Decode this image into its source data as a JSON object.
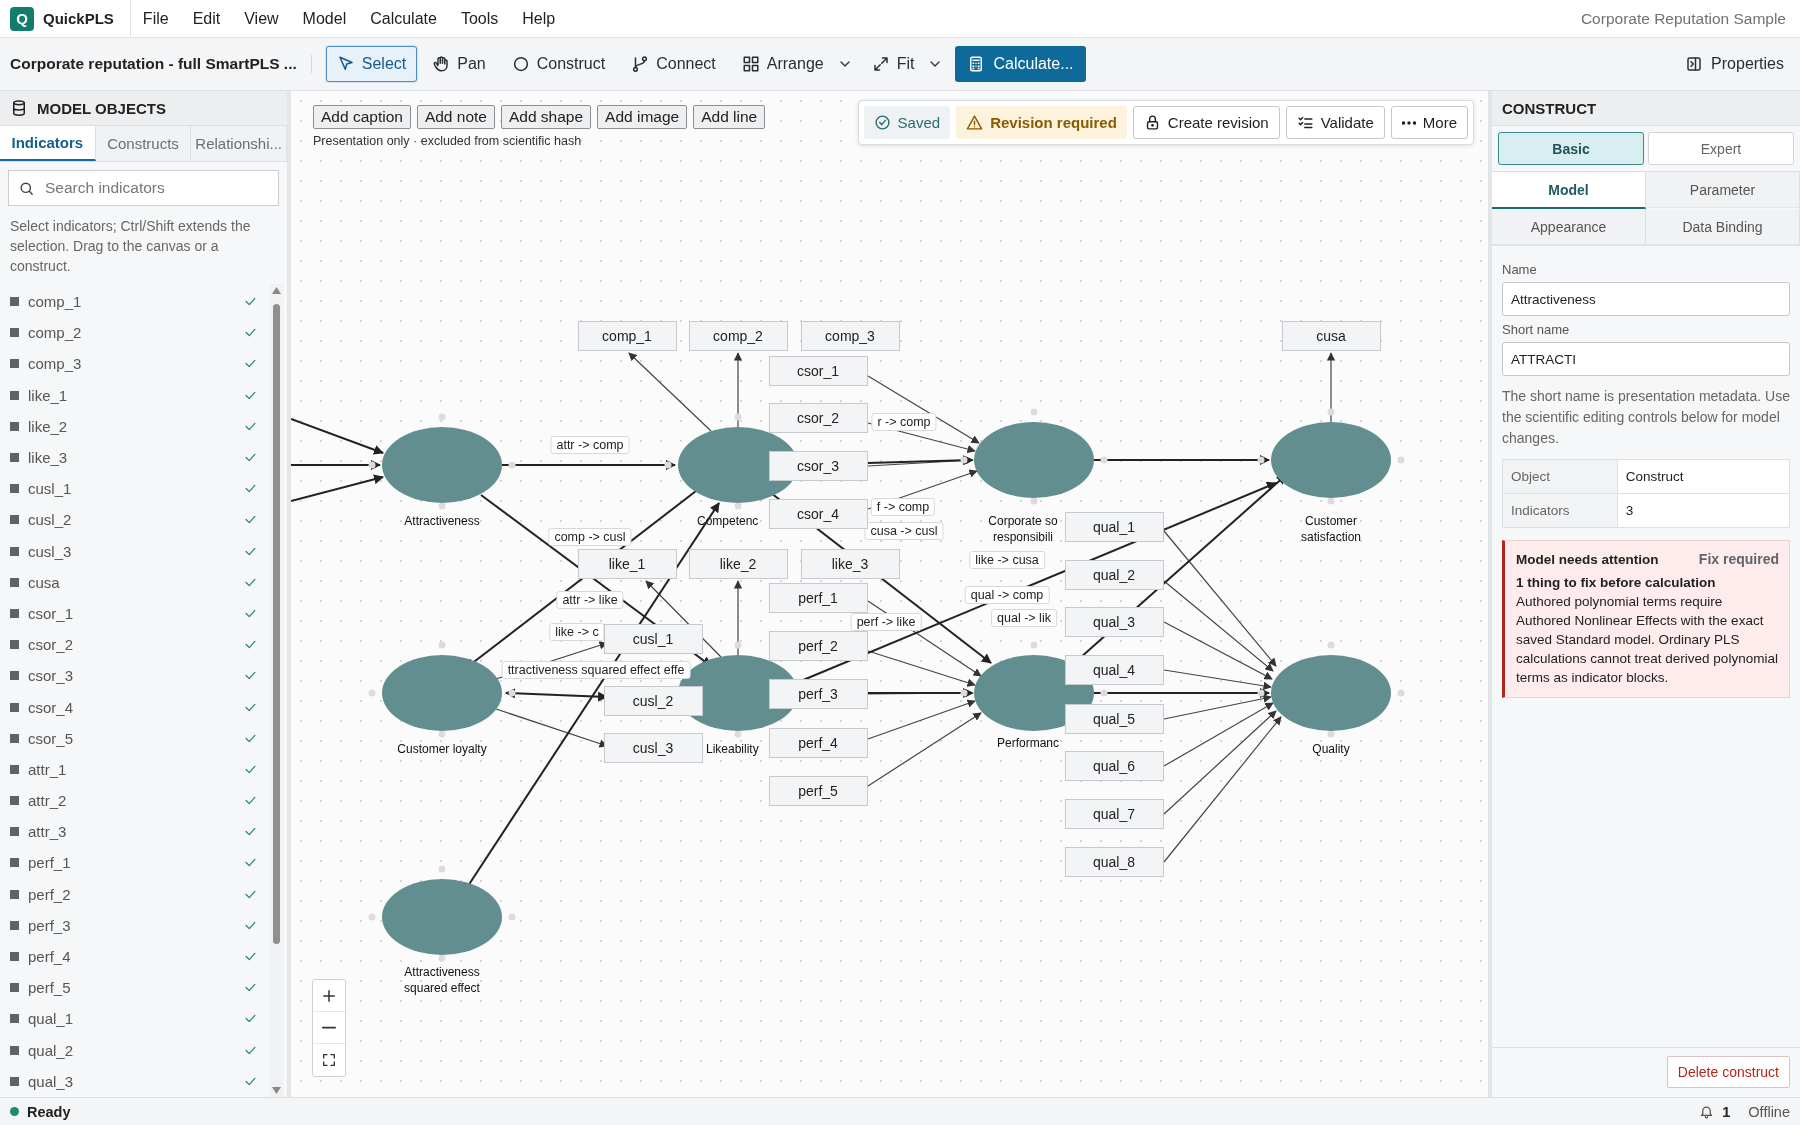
{
  "app": {
    "name": "QuickPLS",
    "logo": "Q"
  },
  "menu": [
    "File",
    "Edit",
    "View",
    "Model",
    "Calculate",
    "Tools",
    "Help"
  ],
  "project_title": "Corporate Reputation Sample",
  "toolbar": {
    "document_title": "Corporate reputation - full SmartPLS ...",
    "tools": [
      {
        "label": "Select",
        "selected": true,
        "menu": false
      },
      {
        "label": "Pan",
        "selected": false,
        "menu": false
      },
      {
        "label": "Construct",
        "selected": false,
        "menu": false
      },
      {
        "label": "Connect",
        "selected": false,
        "menu": false
      },
      {
        "label": "Arrange",
        "selected": false,
        "menu": true
      },
      {
        "label": "Fit",
        "selected": false,
        "menu": true
      }
    ],
    "calculate_button": "Calculate...",
    "properties_button": "Properties"
  },
  "left_panel": {
    "title": "MODEL OBJECTS",
    "tabs": [
      {
        "label": "Indicators",
        "selected": true
      },
      {
        "label": "Constructs",
        "selected": false
      },
      {
        "label": "Relationshi...",
        "selected": false
      }
    ],
    "search": {
      "placeholder": "Search indicators"
    },
    "hint": "Select indicators; Ctrl/Shift extends the selection. Drag to the canvas or a construct.",
    "indicators": [
      {
        "name": "comp_1",
        "assigned": true
      },
      {
        "name": "comp_2",
        "assigned": true
      },
      {
        "name": "comp_3",
        "assigned": true
      },
      {
        "name": "like_1",
        "assigned": true
      },
      {
        "name": "like_2",
        "assigned": true
      },
      {
        "name": "like_3",
        "assigned": true
      },
      {
        "name": "cusl_1",
        "assigned": true
      },
      {
        "name": "cusl_2",
        "assigned": true
      },
      {
        "name": "cusl_3",
        "assigned": true
      },
      {
        "name": "cusa",
        "assigned": true
      },
      {
        "name": "csor_1",
        "assigned": true
      },
      {
        "name": "csor_2",
        "assigned": true
      },
      {
        "name": "csor_3",
        "assigned": true
      },
      {
        "name": "csor_4",
        "assigned": true
      },
      {
        "name": "csor_5",
        "assigned": true
      },
      {
        "name": "attr_1",
        "assigned": true
      },
      {
        "name": "attr_2",
        "assigned": true
      },
      {
        "name": "attr_3",
        "assigned": true
      },
      {
        "name": "perf_1",
        "assigned": true
      },
      {
        "name": "perf_2",
        "assigned": true
      },
      {
        "name": "perf_3",
        "assigned": true
      },
      {
        "name": "perf_4",
        "assigned": true
      },
      {
        "name": "perf_5",
        "assigned": true
      },
      {
        "name": "qual_1",
        "assigned": true
      },
      {
        "name": "qual_2",
        "assigned": true
      },
      {
        "name": "qual_3",
        "assigned": true
      }
    ]
  },
  "canvas": {
    "presentation_buttons": [
      "Add caption",
      "Add note",
      "Add shape",
      "Add image",
      "Add line"
    ],
    "presentation_note": "Presentation only · excluded from scientific hash",
    "saved_status": "Saved",
    "revision_status": "Revision required",
    "actions": [
      "Create revision",
      "Validate",
      "More"
    ],
    "constructs": [
      {
        "lines": [
          "Attractiveness"
        ]
      },
      {
        "lines": [
          "Competenc"
        ]
      },
      {
        "lines": [
          "Corporate so",
          "responsibili"
        ]
      },
      {
        "lines": [
          "Customer",
          "satisfaction"
        ]
      },
      {
        "lines": [
          "Customer loyalty"
        ]
      },
      {
        "lines": [
          "Likeability"
        ]
      },
      {
        "lines": [
          "Performanc"
        ]
      },
      {
        "lines": [
          "Quality"
        ]
      },
      {
        "lines": [
          "Attractiveness",
          "squared effect"
        ]
      }
    ],
    "indicators": [
      "comp_1",
      "comp_2",
      "comp_3",
      "cusa",
      "csor_1",
      "csor_2",
      "csor_3",
      "csor_4",
      "like_1",
      "like_2",
      "like_3",
      "perf_1",
      "perf_2",
      "perf_3",
      "perf_4",
      "perf_5",
      "cusl_1",
      "cusl_2",
      "cusl_3",
      "qual_1",
      "qual_2",
      "qual_3",
      "qual_4",
      "qual_5",
      "qual_6",
      "qual_7",
      "qual_8"
    ],
    "path_labels": [
      "attr -> comp",
      "r -> comp",
      "f -> comp",
      "cusa -> cusl",
      "comp -> cusl",
      "attr -> like",
      "like -> c",
      "ttractiveness squared effect effe",
      "like -> cusa",
      "qual -> comp",
      "qual -> lik",
      "perf -> like"
    ]
  },
  "right_panel": {
    "title": "CONSTRUCT",
    "modes": [
      {
        "label": "Basic",
        "selected": true
      },
      {
        "label": "Expert",
        "selected": false
      }
    ],
    "tabs": [
      {
        "label": "Model",
        "selected": true
      },
      {
        "label": "Parameter",
        "selected": false
      },
      {
        "label": "Appearance",
        "selected": false
      },
      {
        "label": "Data Binding",
        "selected": false
      }
    ],
    "fields": [
      {
        "label": "Name",
        "value": "Attractiveness"
      },
      {
        "label": "Short name",
        "value": "ATTRACTI"
      }
    ],
    "note": "The short name is presentation metadata. Use the scientific editing controls below for model changes.",
    "properties": [
      {
        "key": "Object",
        "value": "Construct"
      },
      {
        "key": "Indicators",
        "value": "3"
      }
    ],
    "alert": {
      "title": "Model needs attention",
      "badge": "Fix required",
      "subtitle": "1 thing to fix before calculation",
      "body": "Authored polynomial terms require Authored Nonlinear Effects with the exact saved Standard model. Ordinary PLS calculations cannot treat derived polynomial terms as indicator blocks."
    },
    "delete_button": "Delete construct"
  },
  "status_bar": {
    "status": "Ready",
    "notifications": "1",
    "connection": "Offline"
  }
}
